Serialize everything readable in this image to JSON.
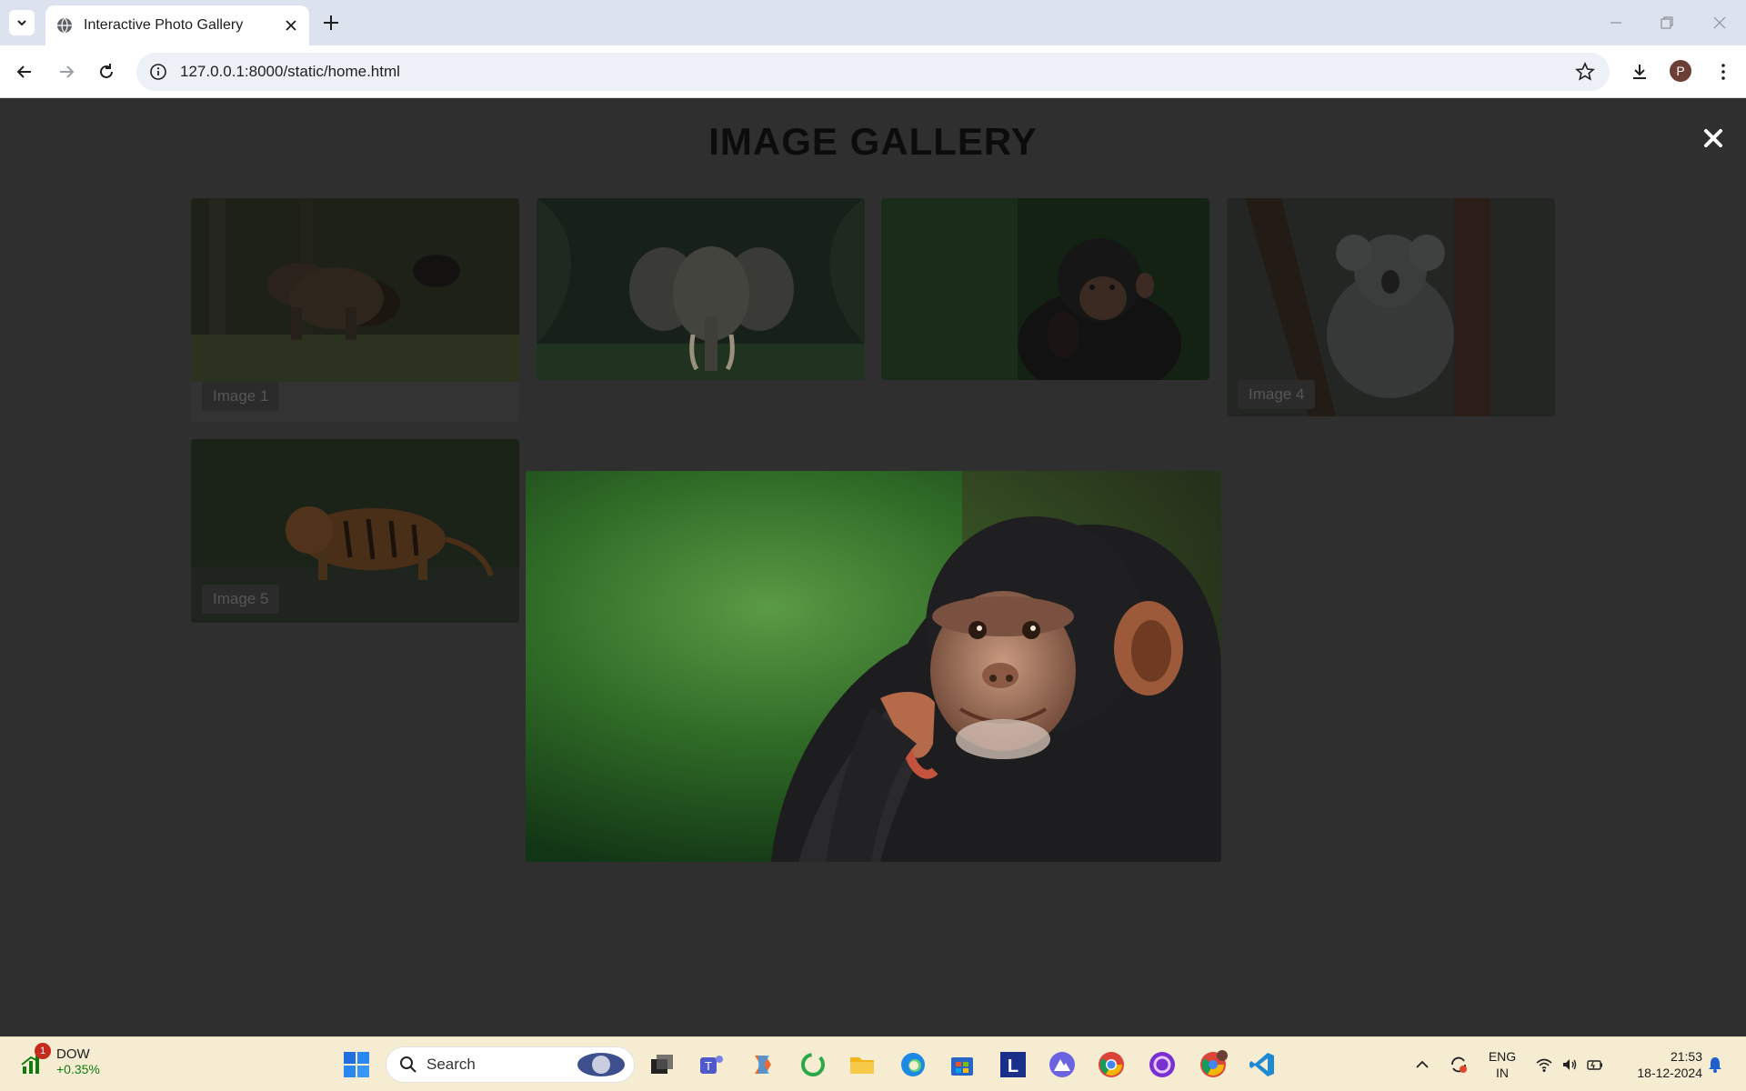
{
  "browser": {
    "tab_title": "Interactive Photo Gallery",
    "url": "127.0.0.1:8000/static/home.html",
    "profile_initial": "P"
  },
  "gallery": {
    "title": "IMAGE GALLERY",
    "captions": [
      "Image 1",
      "Image 4",
      "Image 5"
    ],
    "images": [
      {
        "subject": "bear"
      },
      {
        "subject": "elephant"
      },
      {
        "subject": "chimpanzee"
      },
      {
        "subject": "koala"
      },
      {
        "subject": "tiger"
      }
    ],
    "lightbox_subject": "chimpanzee"
  },
  "taskbar": {
    "stock_name": "DOW",
    "stock_change": "+0.35%",
    "stock_badge": "1",
    "search_label": "Search",
    "lang_line1": "ENG",
    "lang_line2": "IN",
    "time": "21:53",
    "date": "18-12-2024"
  },
  "colors": {
    "page_bg": "#2f2f2f",
    "taskbar_bg": "#f5ecd2",
    "stock_up": "#107c10"
  }
}
